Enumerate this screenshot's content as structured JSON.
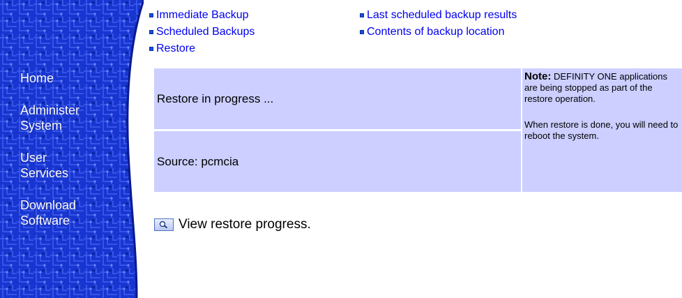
{
  "sidebar": {
    "items": [
      {
        "line1": "Home",
        "line2": ""
      },
      {
        "line1": "Administer",
        "line2": "System"
      },
      {
        "line1": "User",
        "line2": "Services"
      },
      {
        "line1": "Download",
        "line2": "Software"
      }
    ]
  },
  "links": {
    "immediate_backup": "Immediate Backup",
    "scheduled_backups": "Scheduled Backups",
    "restore": "Restore",
    "last_scheduled_results": "Last scheduled backup results",
    "contents_backup_location": "Contents of backup location"
  },
  "status": {
    "progress_text": "Restore in progress ...",
    "source_label": "Source:",
    "source_value": "pcmcia",
    "note_label": "Note:",
    "note_product": "DEFINITY ONE",
    "note_text1": "applications are being stopped as part of the restore operation.",
    "note_text2": "When restore is done, you will need to reboot the system."
  },
  "view_progress": {
    "label": "View restore progress."
  },
  "colors": {
    "sidebar_blue": "#1530c8",
    "table_bg": "#cccfff",
    "link": "#0000ee"
  },
  "icons": {
    "bullet": "square-bullet-icon",
    "view": "magnifier-icon"
  }
}
